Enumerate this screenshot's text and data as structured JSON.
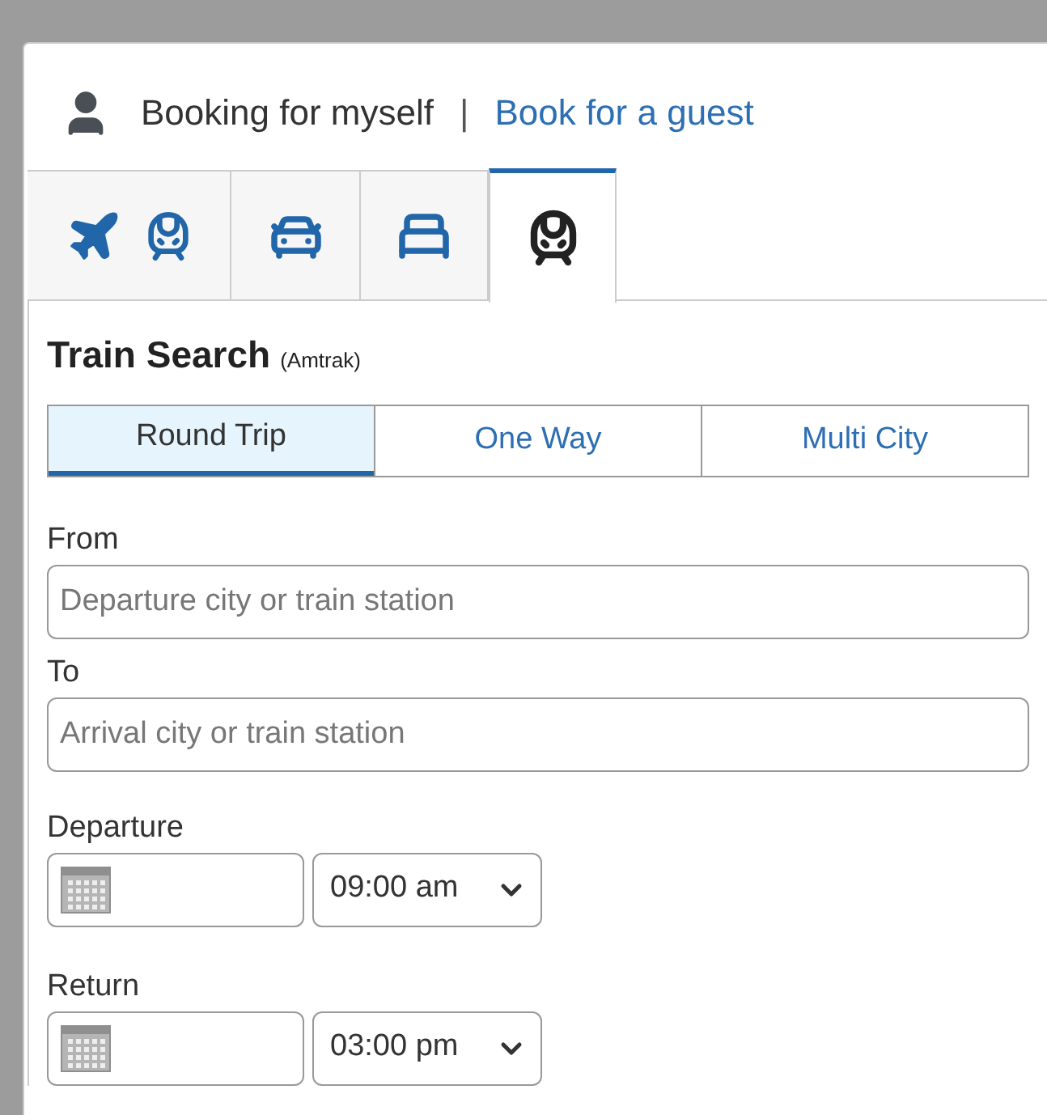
{
  "booking": {
    "self_label": "Booking for myself",
    "separator": "|",
    "guest_link": "Book for a guest"
  },
  "mode_tabs": [
    {
      "kind": "flight-train",
      "selected": false
    },
    {
      "kind": "car",
      "selected": false
    },
    {
      "kind": "hotel",
      "selected": false
    },
    {
      "kind": "train",
      "selected": true
    }
  ],
  "search": {
    "title": "Train Search",
    "subtitle": "(Amtrak)"
  },
  "trip_tabs": [
    {
      "label": "Round Trip",
      "selected": true
    },
    {
      "label": "One Way",
      "selected": false
    },
    {
      "label": "Multi City",
      "selected": false
    }
  ],
  "fields": [
    {
      "label": "From",
      "placeholder": "Departure city or train station"
    },
    {
      "label": "To",
      "placeholder": "Arrival city or train station"
    }
  ],
  "dates": [
    {
      "label": "Departure",
      "time": "09:00 am"
    },
    {
      "label": "Return",
      "time": "03:00 pm"
    }
  ]
}
